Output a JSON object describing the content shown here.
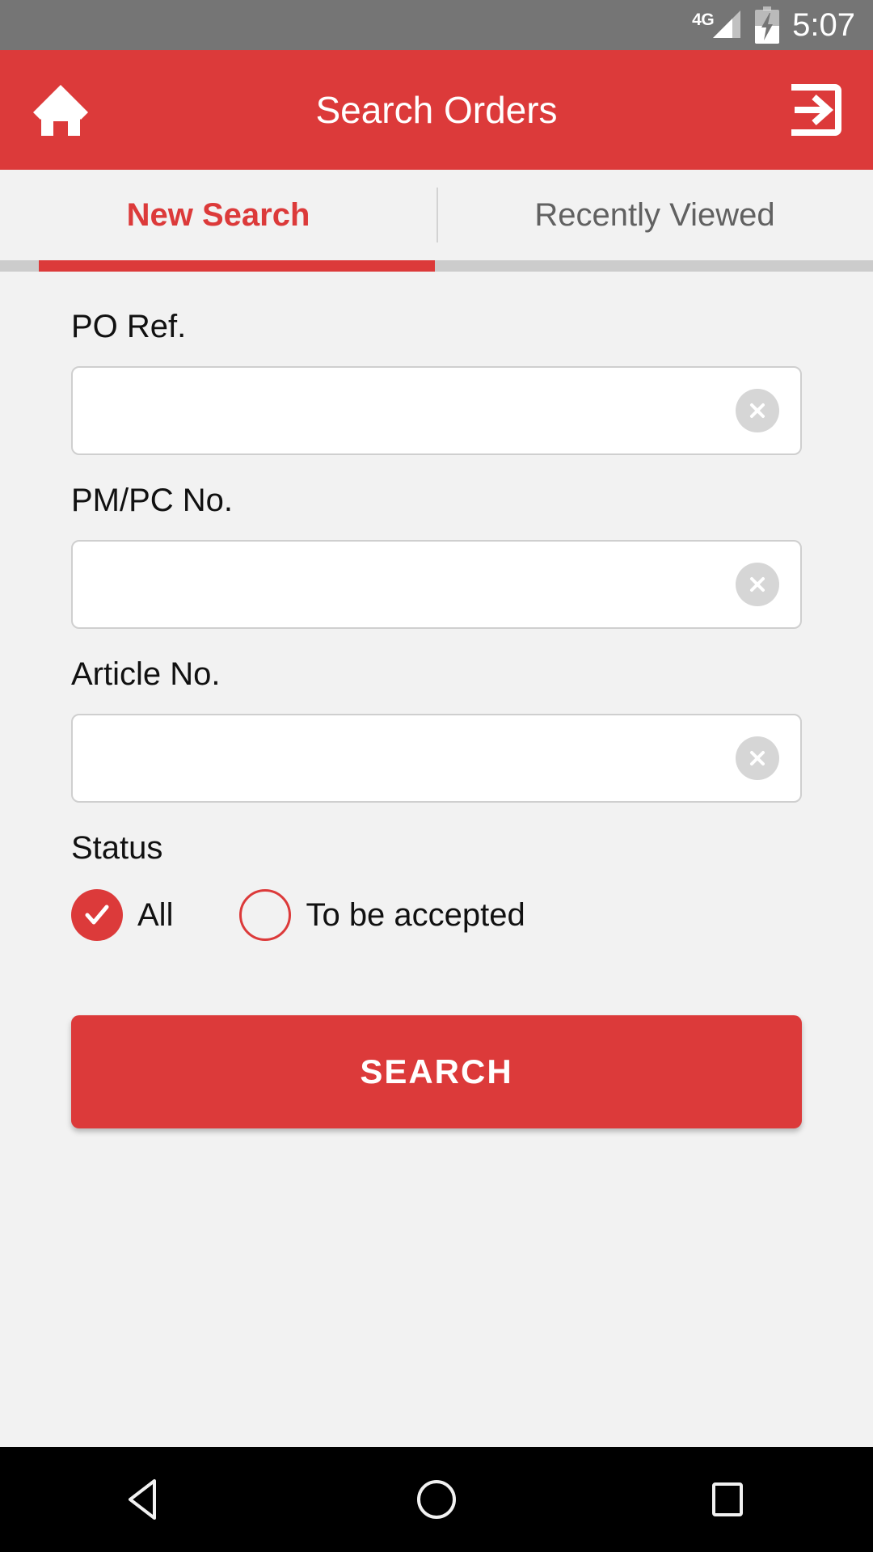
{
  "status_bar": {
    "network": "4G",
    "time": "5:07",
    "battery_icon": "battery-charging-icon",
    "signal_icon": "signal-bars-icon"
  },
  "app_bar": {
    "title": "Search Orders",
    "home_icon": "home-icon",
    "logout_icon": "logout-icon",
    "background_color": "#dc3a3a"
  },
  "tabs": [
    {
      "label": "New Search",
      "active": true
    },
    {
      "label": "Recently Viewed",
      "active": false
    }
  ],
  "form": {
    "fields": [
      {
        "label": "PO Ref.",
        "value": "",
        "placeholder": "",
        "clear_icon": "clear-circle-icon"
      },
      {
        "label": "PM/PC No.",
        "value": "",
        "placeholder": "",
        "clear_icon": "clear-circle-icon"
      },
      {
        "label": "Article No.",
        "value": "",
        "placeholder": "",
        "clear_icon": "clear-circle-icon"
      }
    ],
    "status": {
      "label": "Status",
      "options": [
        {
          "label": "All",
          "selected": true
        },
        {
          "label": "To be accepted",
          "selected": false
        }
      ]
    },
    "submit_label": "SEARCH"
  },
  "nav_bar": {
    "back_icon": "back-triangle-icon",
    "home_icon": "home-circle-icon",
    "recents_icon": "recents-square-icon"
  },
  "colors": {
    "accent": "#dc3a3a",
    "status_bar": "#757575",
    "page_background": "#f2f2f2",
    "nav_bar": "#000000"
  }
}
